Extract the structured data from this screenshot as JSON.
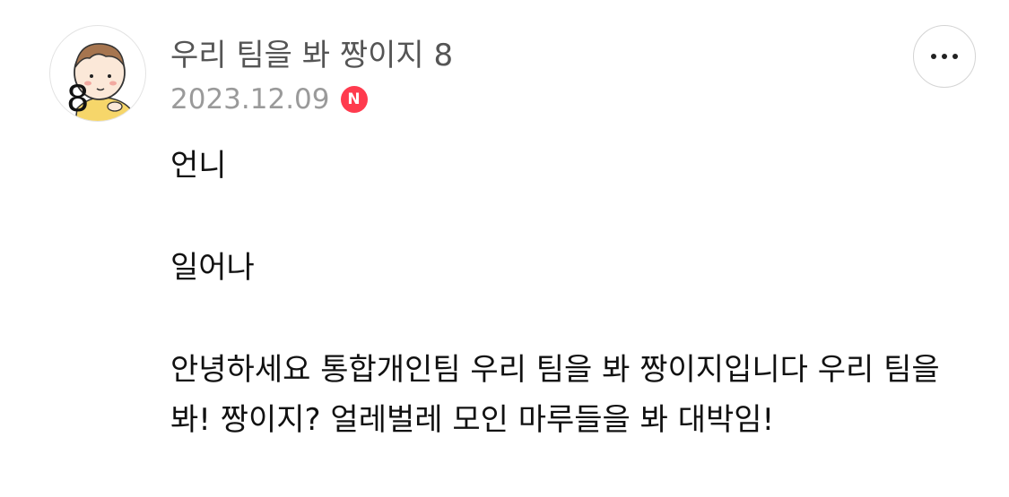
{
  "comment": {
    "author_name": "우리 팀을 봐 짱이지 8",
    "date": "2023.12.09",
    "new_badge": "N",
    "avatar_label": "8",
    "paragraphs": [
      "언니",
      "일어나",
      "안녕하세요 통합개인팀 우리 팀을 봐 짱이지입니다 우리 팀을 봐! 짱이지? 얼레벌레 모인 마루들을 봐 대박임!"
    ]
  },
  "icons": {
    "more": "more-horizontal-icon",
    "avatar": "cartoon-baby-avatar"
  },
  "colors": {
    "author": "#555555",
    "date": "#9a9a9a",
    "badge": "#ff3b4e",
    "text": "#111111"
  }
}
